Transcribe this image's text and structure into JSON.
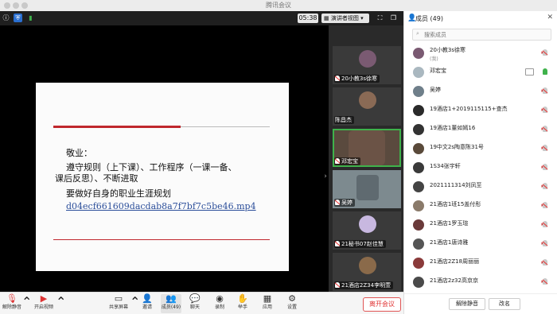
{
  "window": {
    "title": "腾讯会议"
  },
  "top_bar": {
    "time": "05:38",
    "view_button": "演讲者视图"
  },
  "slide": {
    "lines": [
      "敬业：",
      "遵守规则（上下课）、工作程序（一课一备、",
      "课后反思）、不断进取",
      "要做好自身的职业生涯规划",
      "d04ecf661609dacdab8a7f7bf7c5be46.mp4"
    ]
  },
  "thumbnails": [
    {
      "name": "20小教3s徐寒",
      "active": false,
      "muted": true,
      "avatar_color": "#7a5a72"
    },
    {
      "name": "陈昌杰",
      "active": false,
      "muted": false,
      "avatar_color": "#8a6a55"
    },
    {
      "name": "邓宏宝",
      "active": true,
      "muted": true,
      "avatar_color": "#6b5346"
    },
    {
      "name": "吴婷",
      "active": false,
      "muted": true,
      "avatar_color": "#6f7f8a"
    },
    {
      "name": "21秘书07赵佳慧",
      "active": false,
      "muted": true,
      "avatar_color": "#c8b8e0"
    },
    {
      "name": "21酒店2Z34李明萱",
      "active": false,
      "muted": true,
      "avatar_color": "#8a6a4a"
    },
    {
      "name": "",
      "active": false,
      "muted": false,
      "avatar_color": "#9a7a62"
    }
  ],
  "toolbar": {
    "items": [
      {
        "label": "解除静音",
        "icon": "mic-muted-icon"
      },
      {
        "label": "开启视频",
        "icon": "video-off-icon"
      },
      {
        "label": "共享屏幕",
        "icon": "share-screen-icon"
      },
      {
        "label": "邀请",
        "icon": "invite-icon"
      },
      {
        "label": "成员(49)",
        "icon": "members-icon"
      },
      {
        "label": "聊天",
        "icon": "chat-icon"
      },
      {
        "label": "录制",
        "icon": "record-icon"
      },
      {
        "label": "举手",
        "icon": "hand-icon"
      },
      {
        "label": "应用",
        "icon": "apps-icon"
      },
      {
        "label": "设置",
        "icon": "settings-icon"
      }
    ],
    "leave_label": "离开会议"
  },
  "panel": {
    "title": "成员 (49)",
    "search_placeholder": "搜索成员",
    "members": [
      {
        "name": "20小教3s徐寒",
        "sub": "(我)",
        "mic": "muted",
        "avatar_color": "#7a5a72"
      },
      {
        "name": "邓宏宝",
        "sub": "",
        "mic": "on",
        "screen": true,
        "avatar_color": "#aab8c0"
      },
      {
        "name": "吴婷",
        "sub": "",
        "mic": "muted",
        "avatar_color": "#6f7f8a"
      },
      {
        "name": "19酒店1+2019115115+查杰",
        "sub": "",
        "mic": "muted",
        "avatar_color": "#2a2a2a"
      },
      {
        "name": "19酒店1董如嫣16",
        "sub": "",
        "mic": "muted",
        "avatar_color": "#333"
      },
      {
        "name": "19中文2s陶意陈31号",
        "sub": "",
        "mic": "muted",
        "avatar_color": "#5a4a3a"
      },
      {
        "name": "1S34张宇轩",
        "sub": "",
        "mic": "muted",
        "avatar_color": "#3a3a3a"
      },
      {
        "name": "2021111314刘凤至",
        "sub": "",
        "mic": "muted",
        "avatar_color": "#444"
      },
      {
        "name": "21酒店1班15盖付彤",
        "sub": "",
        "mic": "muted",
        "avatar_color": "#8a7a6a"
      },
      {
        "name": "21酒店1罗玉瑄",
        "sub": "",
        "mic": "muted",
        "avatar_color": "#6a3a3a"
      },
      {
        "name": "21酒店1唐诗雅",
        "sub": "",
        "mic": "muted",
        "avatar_color": "#555"
      },
      {
        "name": "21酒店2Z18周丽丽",
        "sub": "",
        "mic": "muted",
        "avatar_color": "#8a3a3a"
      },
      {
        "name": "21酒店2z32高京京",
        "sub": "",
        "mic": "muted",
        "avatar_color": "#4a4a4a"
      }
    ],
    "unmute_all": "解除静音",
    "rename": "改名"
  }
}
